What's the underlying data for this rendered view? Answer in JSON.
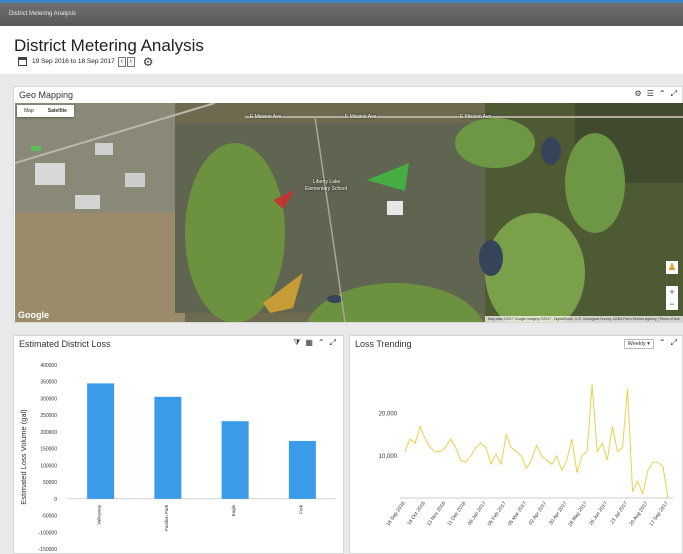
{
  "app": {
    "title": "District Metering Analysis"
  },
  "header": {
    "title": "District Metering Analysis",
    "date_range": "19 Sep 2016 to 18 Sep 2017",
    "prev": "‹",
    "next": "›"
  },
  "geo": {
    "title": "Geo Mapping",
    "map_type": [
      "Map",
      "Satellite"
    ],
    "labels": [
      "E Mission Ave",
      "E Mission Ave",
      "E Mission Ave",
      "Liberty Lake",
      "Elementary School"
    ],
    "google": "Google",
    "attribution": "Map data ©2017 Google Imagery ©2017 , DigitalGlobe, U.S. Geological Survey, USDA Farm Service Agency | Terms of Use",
    "zoom_in": "+",
    "zoom_out": "−"
  },
  "loss_panel": {
    "title": "Estimated District Loss"
  },
  "trend_panel": {
    "title": "Loss Trending",
    "interval": "Weekly ▾"
  },
  "colors": {
    "accent": "#3d86c6",
    "bar": "#3a9be8",
    "line": "#e8d24c"
  },
  "chart_data": [
    {
      "type": "bar",
      "title": "Estimated District Loss",
      "ylabel": "Estimated Loss Volume (gal)",
      "xlabel": "",
      "categories": [
        "Valleyway",
        "Pavilion Park",
        "Eagle",
        "Fork"
      ],
      "values": [
        345000,
        305000,
        232000,
        173000
      ],
      "ylim": [
        -150000,
        400000
      ],
      "yticks": [
        400000,
        350000,
        300000,
        250000,
        200000,
        150000,
        100000,
        50000,
        0,
        -50000,
        -100000,
        -150000
      ],
      "grid": false
    },
    {
      "type": "line",
      "title": "Loss Trending",
      "xlabel": "",
      "ylabel": "",
      "xticks": [
        "18 Sep 2016",
        "16 Oct 2016",
        "13 Nov 2016",
        "11 Dec 2016",
        "08 Jan 2017",
        "05 Feb 2017",
        "05 Mar 2017",
        "02 Apr 2017",
        "30 Apr 2017",
        "28 May 2017",
        "25 Jun 2017",
        "23 Jul 2017",
        "20 Aug 2017",
        "17 Sep 2017"
      ],
      "yticks": [
        10000,
        20000
      ],
      "ytick_labels": [
        "10,000",
        "20,000"
      ],
      "ylim": [
        0,
        28000
      ],
      "series": [
        {
          "x": [
            "18 Sep 2016",
            "25 Sep 2016",
            "02 Oct 2016",
            "09 Oct 2016",
            "16 Oct 2016",
            "23 Oct 2016",
            "30 Oct 2016",
            "06 Nov 2016",
            "13 Nov 2016",
            "20 Nov 2016",
            "27 Nov 2016",
            "04 Dec 2016",
            "11 Dec 2016",
            "18 Dec 2016",
            "25 Dec 2016",
            "01 Jan 2017",
            "08 Jan 2017",
            "15 Jan 2017",
            "22 Jan 2017",
            "29 Jan 2017",
            "05 Feb 2017",
            "12 Feb 2017",
            "19 Feb 2017",
            "26 Feb 2017",
            "05 Mar 2017",
            "12 Mar 2017",
            "19 Mar 2017",
            "26 Mar 2017",
            "02 Apr 2017",
            "09 Apr 2017",
            "16 Apr 2017",
            "23 Apr 2017",
            "30 Apr 2017",
            "07 May 2017",
            "14 May 2017",
            "21 May 2017",
            "28 May 2017",
            "04 Jun 2017",
            "11 Jun 2017",
            "18 Jun 2017",
            "25 Jun 2017",
            "02 Jul 2017",
            "09 Jul 2017",
            "16 Jul 2017",
            "23 Jul 2017",
            "30 Jul 2017",
            "06 Aug 2017",
            "13 Aug 2017",
            "20 Aug 2017",
            "27 Aug 2017",
            "03 Sep 2017",
            "10 Sep 2017",
            "17 Sep 2017"
          ],
          "values": [
            11000,
            14000,
            13000,
            17000,
            14000,
            12000,
            11000,
            11000,
            12000,
            14000,
            12000,
            9000,
            8500,
            10000,
            12000,
            13000,
            12000,
            8000,
            10500,
            8000,
            15000,
            12000,
            11000,
            10000,
            7000,
            9000,
            12500,
            10000,
            9000,
            8000,
            10000,
            6500,
            9000,
            14000,
            6000,
            10000,
            11000,
            27000,
            11000,
            13000,
            9000,
            17000,
            11000,
            12000,
            26000,
            1500,
            4000,
            1000,
            6500,
            8500,
            8500,
            7500,
            0
          ]
        }
      ]
    }
  ]
}
